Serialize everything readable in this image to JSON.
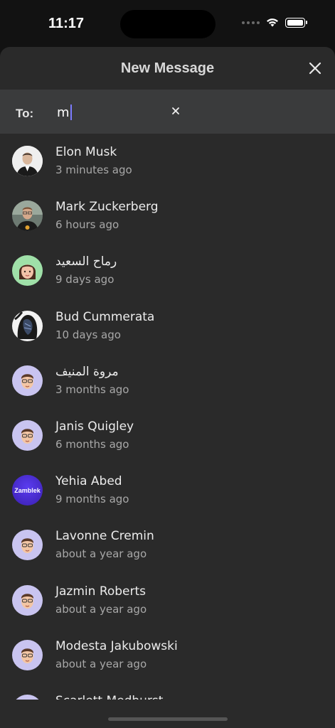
{
  "status_bar": {
    "time": "11:17"
  },
  "header": {
    "title": "New Message"
  },
  "to_bar": {
    "label": "To:",
    "value": "m"
  },
  "contacts": [
    {
      "name": "Elon Musk",
      "time": "3 minutes ago",
      "avatar": "photo-elon"
    },
    {
      "name": "Mark Zuckerberg",
      "time": "6 hours ago",
      "avatar": "photo-mark"
    },
    {
      "name": "رماح السعيد",
      "time": "9 days ago",
      "avatar": "memoji-woman"
    },
    {
      "name": "Bud Cummerata",
      "time": "10 days ago",
      "avatar": "photo-art"
    },
    {
      "name": "مروة المنيف",
      "time": "3 months ago",
      "avatar": "memoji-man"
    },
    {
      "name": "Janis Quigley",
      "time": "6 months ago",
      "avatar": "memoji-man"
    },
    {
      "name": "Yehia Abed",
      "time": "9 months ago",
      "avatar": "logo-zamblek",
      "logo_text": "Zamblek"
    },
    {
      "name": "Lavonne Cremin",
      "time": "about a year ago",
      "avatar": "memoji-man"
    },
    {
      "name": "Jazmin Roberts",
      "time": "about a year ago",
      "avatar": "memoji-man"
    },
    {
      "name": "Modesta Jakubowski",
      "time": "about a year ago",
      "avatar": "memoji-man"
    },
    {
      "name": "Scarlett Medhurst",
      "time": "",
      "avatar": "memoji-man"
    }
  ],
  "colors": {
    "sheet_bg": "#2a2a2a",
    "to_bar_bg": "#3a3b3c",
    "memoji_bg": "#c9c4f0",
    "memoji_woman_bg": "#9fe0a8",
    "zamblek_bg": "#4a2fd6"
  }
}
